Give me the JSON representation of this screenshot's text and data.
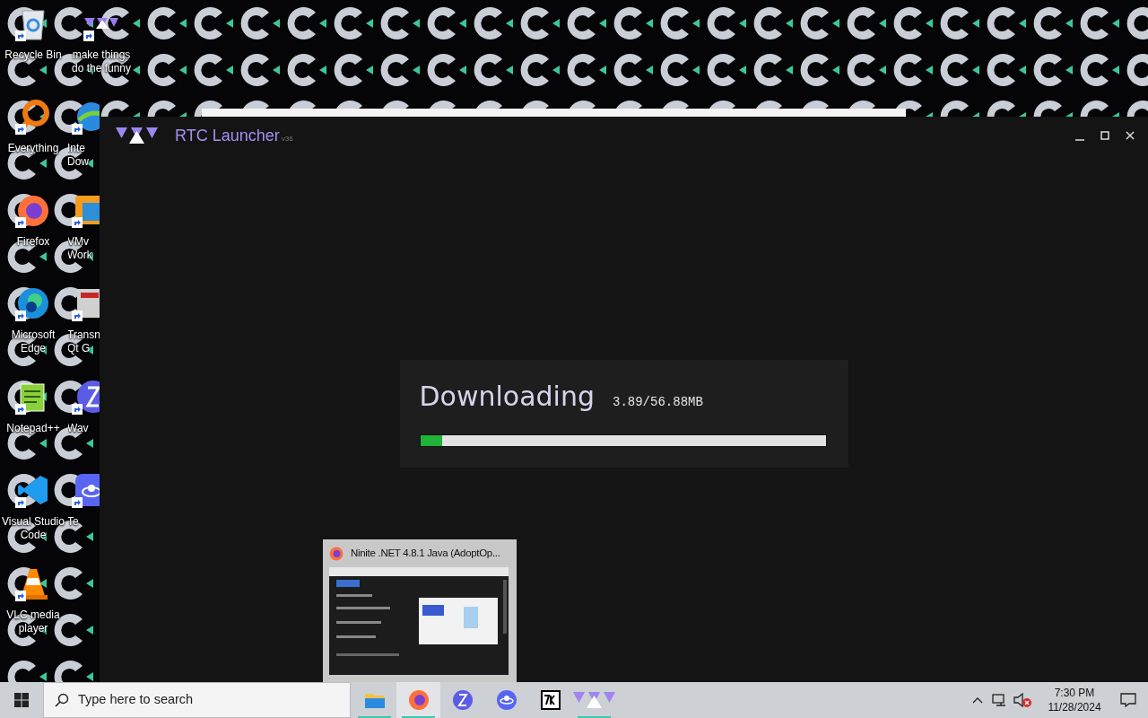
{
  "desktop": {
    "icons": [
      {
        "lines": [
          "Recycle Bin"
        ]
      },
      {
        "lines": [
          "Everything"
        ]
      },
      {
        "lines": [
          "Firefox"
        ]
      },
      {
        "lines": [
          "Microsoft",
          "Edge"
        ]
      },
      {
        "lines": [
          "Notepad++"
        ]
      },
      {
        "lines": [
          "Visual Studio",
          "Code"
        ]
      },
      {
        "lines": [
          "VLC media",
          "player"
        ]
      }
    ],
    "partial_icons": [
      {
        "lines": [
          "make things",
          "do the funny"
        ]
      },
      {
        "lines": [
          "Inte",
          "Dow"
        ]
      },
      {
        "lines": [
          "VMv",
          "Work"
        ]
      },
      {
        "lines": [
          "Transn",
          "Qt G"
        ]
      },
      {
        "lines": [
          "Wav"
        ]
      },
      {
        "lines": [
          "Te"
        ]
      }
    ]
  },
  "window": {
    "title": "RTC Launcher",
    "version": "v36"
  },
  "download": {
    "title": "Downloading",
    "reading": "3.89/56.88MB",
    "level": 0.055
  },
  "preview": {
    "title": "Ninite .NET 4.8.1 Java (AdoptOp..."
  },
  "taskbar": {
    "search": {
      "placeholder": "Type here to search"
    },
    "apps": [
      {
        "running": true,
        "selected": false
      },
      {
        "running": true,
        "selected": true
      },
      {
        "running": false,
        "selected": false
      },
      {
        "running": false,
        "selected": false
      },
      {
        "running": false,
        "selected": false
      },
      {
        "running": true,
        "selected": false
      }
    ],
    "time": "7:30 PM",
    "date": "11/28/2024",
    "volume_muted": true
  }
}
